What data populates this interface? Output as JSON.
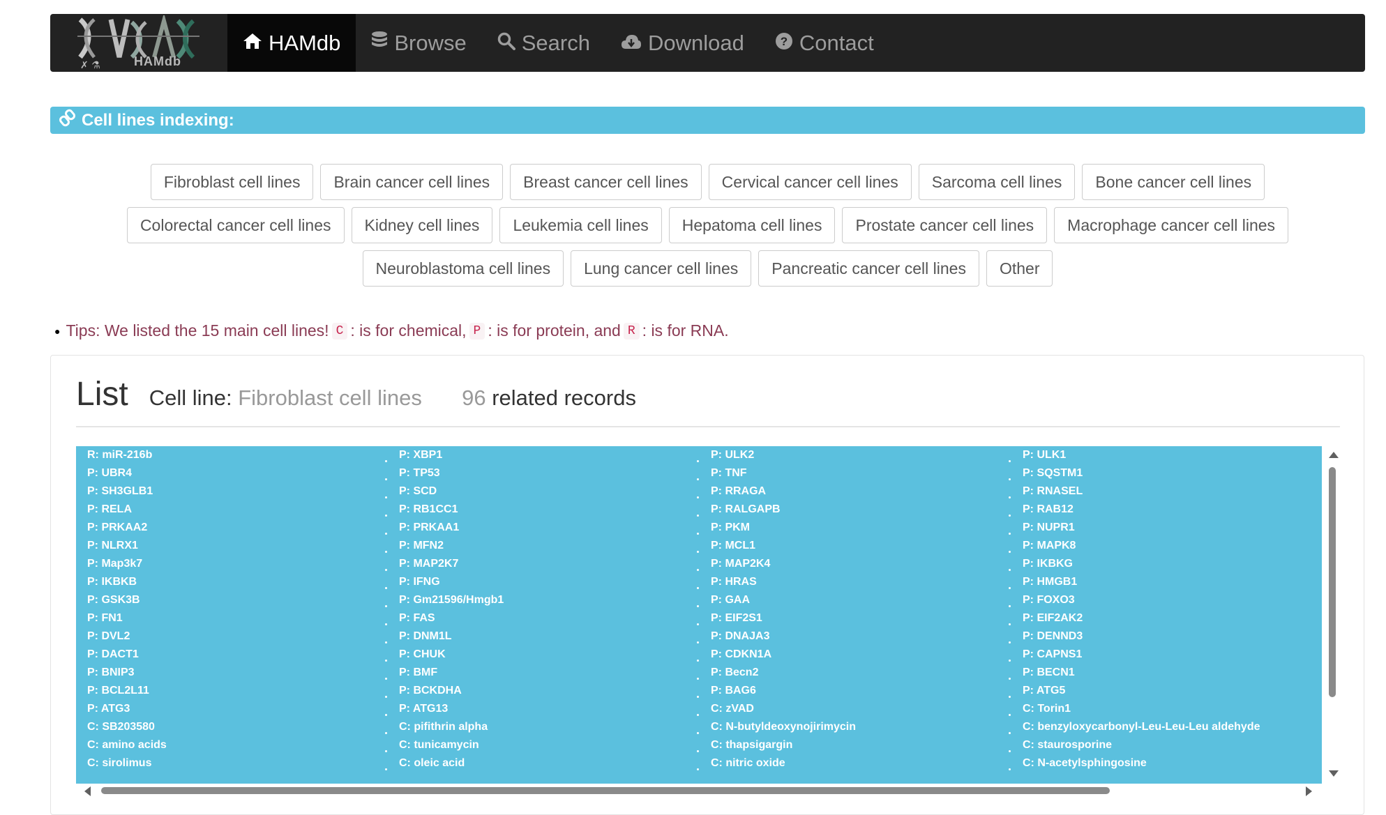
{
  "navbar": {
    "brand_text": "HAMdb",
    "items": [
      {
        "label": "HAMdb",
        "icon": "home-icon",
        "active": true
      },
      {
        "label": "Browse",
        "icon": "database-icon",
        "active": false
      },
      {
        "label": "Search",
        "icon": "search-icon",
        "active": false
      },
      {
        "label": "Download",
        "icon": "cloud-download-icon",
        "active": false
      },
      {
        "label": "Contact",
        "icon": "question-circle-icon",
        "active": false
      }
    ]
  },
  "heading": {
    "title": "Cell lines indexing:",
    "icon": "link-icon"
  },
  "cell_line_buttons": [
    [
      "Fibroblast cell lines",
      "Brain cancer cell lines",
      "Breast cancer cell lines",
      "Cervical cancer cell lines",
      "Sarcoma cell lines",
      "Bone cancer cell lines"
    ],
    [
      "Colorectal cancer cell lines",
      "Kidney cell lines",
      "Leukemia cell lines",
      "Hepatoma cell lines",
      "Prostate cancer cell lines",
      "Macrophage cancer cell lines"
    ],
    [
      "Neuroblastoma cell lines",
      "Lung cancer cell lines",
      "Pancreatic cancer cell lines",
      "Other"
    ]
  ],
  "tips": {
    "prefix": "Tips: We listed the 15 main cell lines!",
    "c_code": "C",
    "c_text": ": is for chemical,",
    "p_code": "P",
    "p_text": ": is for protein, and",
    "r_code": "R",
    "r_text": ": is for RNA."
  },
  "list": {
    "title": "List",
    "cell_line_label": "Cell line:",
    "cell_line_value": "Fibroblast cell lines",
    "record_count": "96",
    "record_suffix": "related records"
  },
  "records": [
    [
      "R: miR-216b",
      "P: UBR4",
      "P: SH3GLB1",
      "P: RELA",
      "P: PRKAA2",
      "P: NLRX1",
      "P: Map3k7",
      "P: IKBKB",
      "P: GSK3B",
      "P: FN1",
      "P: DVL2",
      "P: DACT1",
      "P: BNIP3",
      "P: BCL2L11",
      "P: ATG3",
      "C: SB203580",
      "C: amino acids",
      "C: sirolimus"
    ],
    [
      "P: XBP1",
      "P: TP53",
      "P: SCD",
      "P: RB1CC1",
      "P: PRKAA1",
      "P: MFN2",
      "P: MAP2K7",
      "P: IFNG",
      "P: Gm21596/Hmgb1",
      "P: FAS",
      "P: DNM1L",
      "P: CHUK",
      "P: BMF",
      "P: BCKDHA",
      "P: ATG13",
      "C: pifithrin alpha",
      "C: tunicamycin",
      "C: oleic acid"
    ],
    [
      "P: ULK2",
      "P: TNF",
      "P: RRAGA",
      "P: RALGAPB",
      "P: PKM",
      "P: MCL1",
      "P: MAP2K4",
      "P: HRAS",
      "P: GAA",
      "P: EIF2S1",
      "P: DNAJA3",
      "P: CDKN1A",
      "P: Becn2",
      "P: BAG6",
      "C: zVAD",
      "C: N-butyldeoxynojirimycin",
      "C: thapsigargin",
      "C: nitric oxide"
    ],
    [
      "P: ULK1",
      "P: SQSTM1",
      "P: RNASEL",
      "P: RAB12",
      "P: NUPR1",
      "P: MAPK8",
      "P: IKBKG",
      "P: HMGB1",
      "P: FOXO3",
      "P: EIF2AK2",
      "P: DENND3",
      "P: CAPNS1",
      "P: BECN1",
      "P: ATG5",
      "C: Torin1",
      "C: benzyloxycarbonyl-Leu-Leu-Leu aldehyde",
      "C: staurosporine",
      "C: N-acetylsphingosine"
    ]
  ],
  "colors": {
    "navbar_bg": "#222222",
    "navbar_active_bg": "#080808",
    "info_blue": "#5bc0de",
    "tips_text": "#8a3b54",
    "code_red": "#c7254e"
  }
}
